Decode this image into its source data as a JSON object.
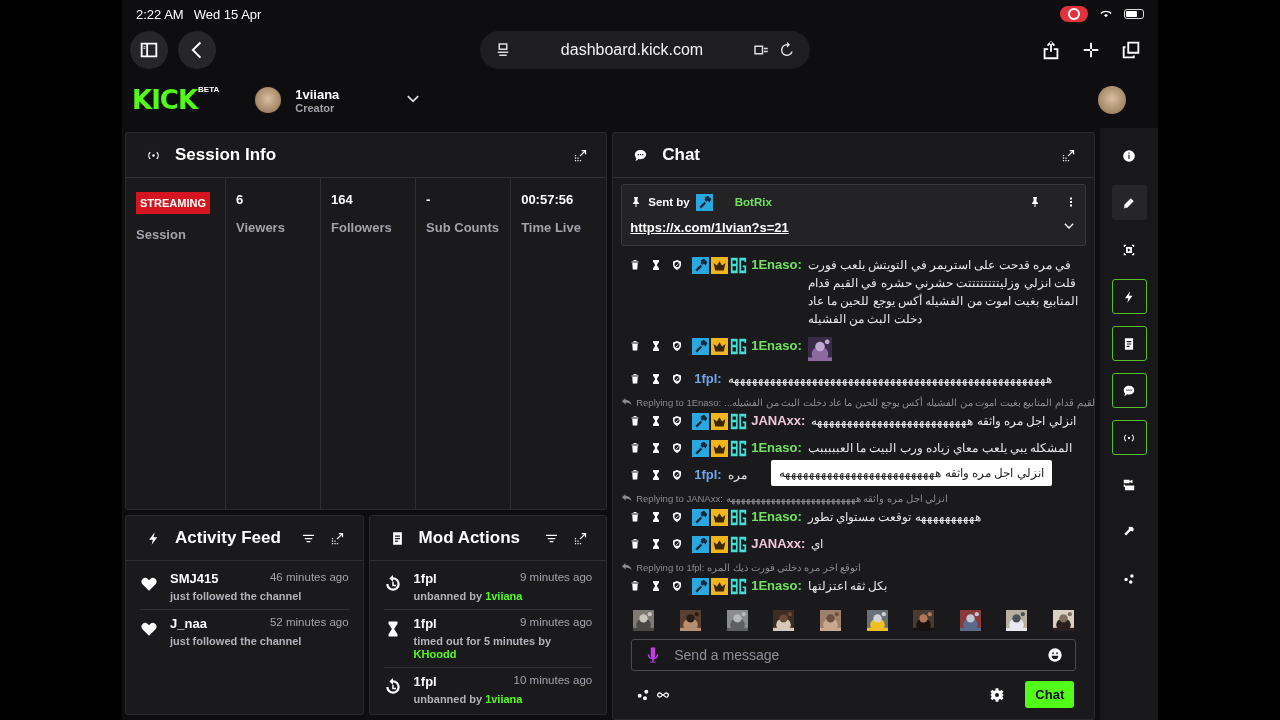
{
  "status_bar": {
    "time": "2:22 AM",
    "date": "Wed 15 Apr"
  },
  "browser": {
    "url": "dashboard.kick.com"
  },
  "header": {
    "logo": "KICK",
    "logo_badge": "BETA",
    "user": "1viiana",
    "role": "Creator"
  },
  "session_info": {
    "title": "Session Info",
    "status": "STREAMING",
    "status_label": "Session",
    "stats": [
      {
        "value": "6",
        "label": "Viewers"
      },
      {
        "value": "164",
        "label": "Followers"
      },
      {
        "value": "-",
        "label": "Sub Counts"
      },
      {
        "value": "00:57:56",
        "label": "Time Live"
      }
    ]
  },
  "activity_feed": {
    "title": "Activity Feed",
    "items": [
      {
        "user": "SMJ415",
        "time": "46 minutes ago",
        "text": "just followed the channel"
      },
      {
        "user": "J_naa",
        "time": "52 minutes ago",
        "text": "just followed the channel"
      }
    ]
  },
  "mod_actions": {
    "title": "Mod Actions",
    "items": [
      {
        "kind": "unban",
        "user": "1fpl",
        "time": "9 minutes ago",
        "action": "unbanned by",
        "by": "1viiana"
      },
      {
        "kind": "timeout",
        "user": "1fpl",
        "time": "9 minutes ago",
        "action": "timed out for 5 minutes by",
        "by": "KHoodd"
      },
      {
        "kind": "unban",
        "user": "1fpl",
        "time": "10 minutes ago",
        "action": "unbanned by",
        "by": "1viiana"
      }
    ]
  },
  "chat": {
    "title": "Chat",
    "pinned": {
      "label": "Sent by",
      "user": "BotRix",
      "link": "https://x.com/1Ivian?s=21"
    },
    "messages": [
      {
        "kind": "message",
        "user": "1Enaso:",
        "color": "#6fe35c",
        "badges": [
          {
            "kind": "mod"
          },
          {
            "kind": "crown"
          },
          {
            "kind": "og"
          }
        ],
        "text": "في مره قدحت على استريمر في التويتش يلعب فورت قلت انزلي وزليتتتتتتتتت حشرني حشره في القيم قدام المتابيع بغيت اموت من الفشيله أكس يوجع للحين ما عاد دخلت البث من الفشيله"
      },
      {
        "kind": "message",
        "user": "1Enaso:",
        "color": "#6fe35c",
        "badges": [
          {
            "kind": "mod"
          },
          {
            "kind": "crown"
          },
          {
            "kind": "og"
          }
        ],
        "emote": {
          "kind": "picture"
        }
      },
      {
        "kind": "message",
        "user": "1fpl:",
        "color": "#6fa6e6",
        "text": "هههههههههههههههههههههههههههههههههههههههههههههههههههههه"
      },
      {
        "kind": "reply",
        "reply_to": "Replying to 1Enaso:",
        "text": "...لقيم قدام المتابيع بغيت اموت من الفشيله أكس يوجع للحين ما عاد دخلت البث من الفشيله"
      },
      {
        "kind": "message",
        "user": "JANAxx:",
        "color": "#efc6d8",
        "badges": [
          {
            "kind": "mod"
          },
          {
            "kind": "crown"
          },
          {
            "kind": "og"
          }
        ],
        "text": "انزلي اجل مره واثقه ههههههههههههههههههههههههههه"
      },
      {
        "kind": "message",
        "user": "1Enaso:",
        "color": "#6fe35c",
        "badges": [
          {
            "kind": "mod"
          },
          {
            "kind": "crown"
          },
          {
            "kind": "og"
          }
        ],
        "text": "المشكله يبي يلعب معاي زياده ورب البيت ما العبببببب"
      },
      {
        "kind": "message",
        "user": "1fpl:",
        "color": "#6fa6e6",
        "text": "مره",
        "tooltip": "انزلي اجل مره واثقه ههههههههههههههههههههههههههه"
      },
      {
        "kind": "reply",
        "reply_to": "Replying to JANAxx:",
        "text": "انزلي اجل مره واثقه ههههههههههههههههههههههههههه"
      },
      {
        "kind": "message",
        "user": "1Enaso:",
        "color": "#6fe35c",
        "badges": [
          {
            "kind": "mod"
          },
          {
            "kind": "crown"
          },
          {
            "kind": "og"
          }
        ],
        "text": "ههههههههههه توقعت مستواي تطور"
      },
      {
        "kind": "message",
        "user": "JANAxx:",
        "color": "#efc6d8",
        "badges": [
          {
            "kind": "mod"
          },
          {
            "kind": "crown"
          },
          {
            "kind": "og"
          }
        ],
        "text": "اي"
      },
      {
        "kind": "reply",
        "reply_to": "Replying to 1fpl:",
        "text": "اتوقع اخر مره دخلتي فورت ذيك المره"
      },
      {
        "kind": "message",
        "user": "1Enaso:",
        "color": "#6fe35c",
        "badges": [
          {
            "kind": "mod"
          },
          {
            "kind": "crown"
          },
          {
            "kind": "og"
          }
        ],
        "text": "بكل ثقه اعتزلتها"
      }
    ],
    "emotes": [
      {
        "kind": "picture"
      },
      {
        "kind": "picture"
      },
      {
        "kind": "picture"
      },
      {
        "kind": "picture"
      },
      {
        "kind": "picture"
      },
      {
        "kind": "picture"
      },
      {
        "kind": "picture"
      },
      {
        "kind": "picture"
      },
      {
        "kind": "picture"
      },
      {
        "kind": "picture"
      }
    ],
    "input": {
      "placeholder": "Send a message"
    },
    "send_button": "Chat"
  },
  "rail": [
    {
      "kind": "info",
      "selected": false,
      "shown": false
    },
    {
      "kind": "pencil",
      "selected": true,
      "shown": false
    },
    {
      "kind": "screen",
      "selected": false,
      "shown": false
    },
    {
      "kind": "bolt",
      "selected": false,
      "shown": true
    },
    {
      "kind": "document",
      "selected": false,
      "shown": true
    },
    {
      "kind": "chat",
      "selected": false,
      "shown": true
    },
    {
      "kind": "broadcast",
      "selected": false,
      "shown": true
    },
    {
      "kind": "camera",
      "selected": false,
      "shown": false
    },
    {
      "kind": "wrench",
      "selected": false,
      "shown": false
    },
    {
      "kind": "dots",
      "selected": false,
      "shown": false
    }
  ]
}
